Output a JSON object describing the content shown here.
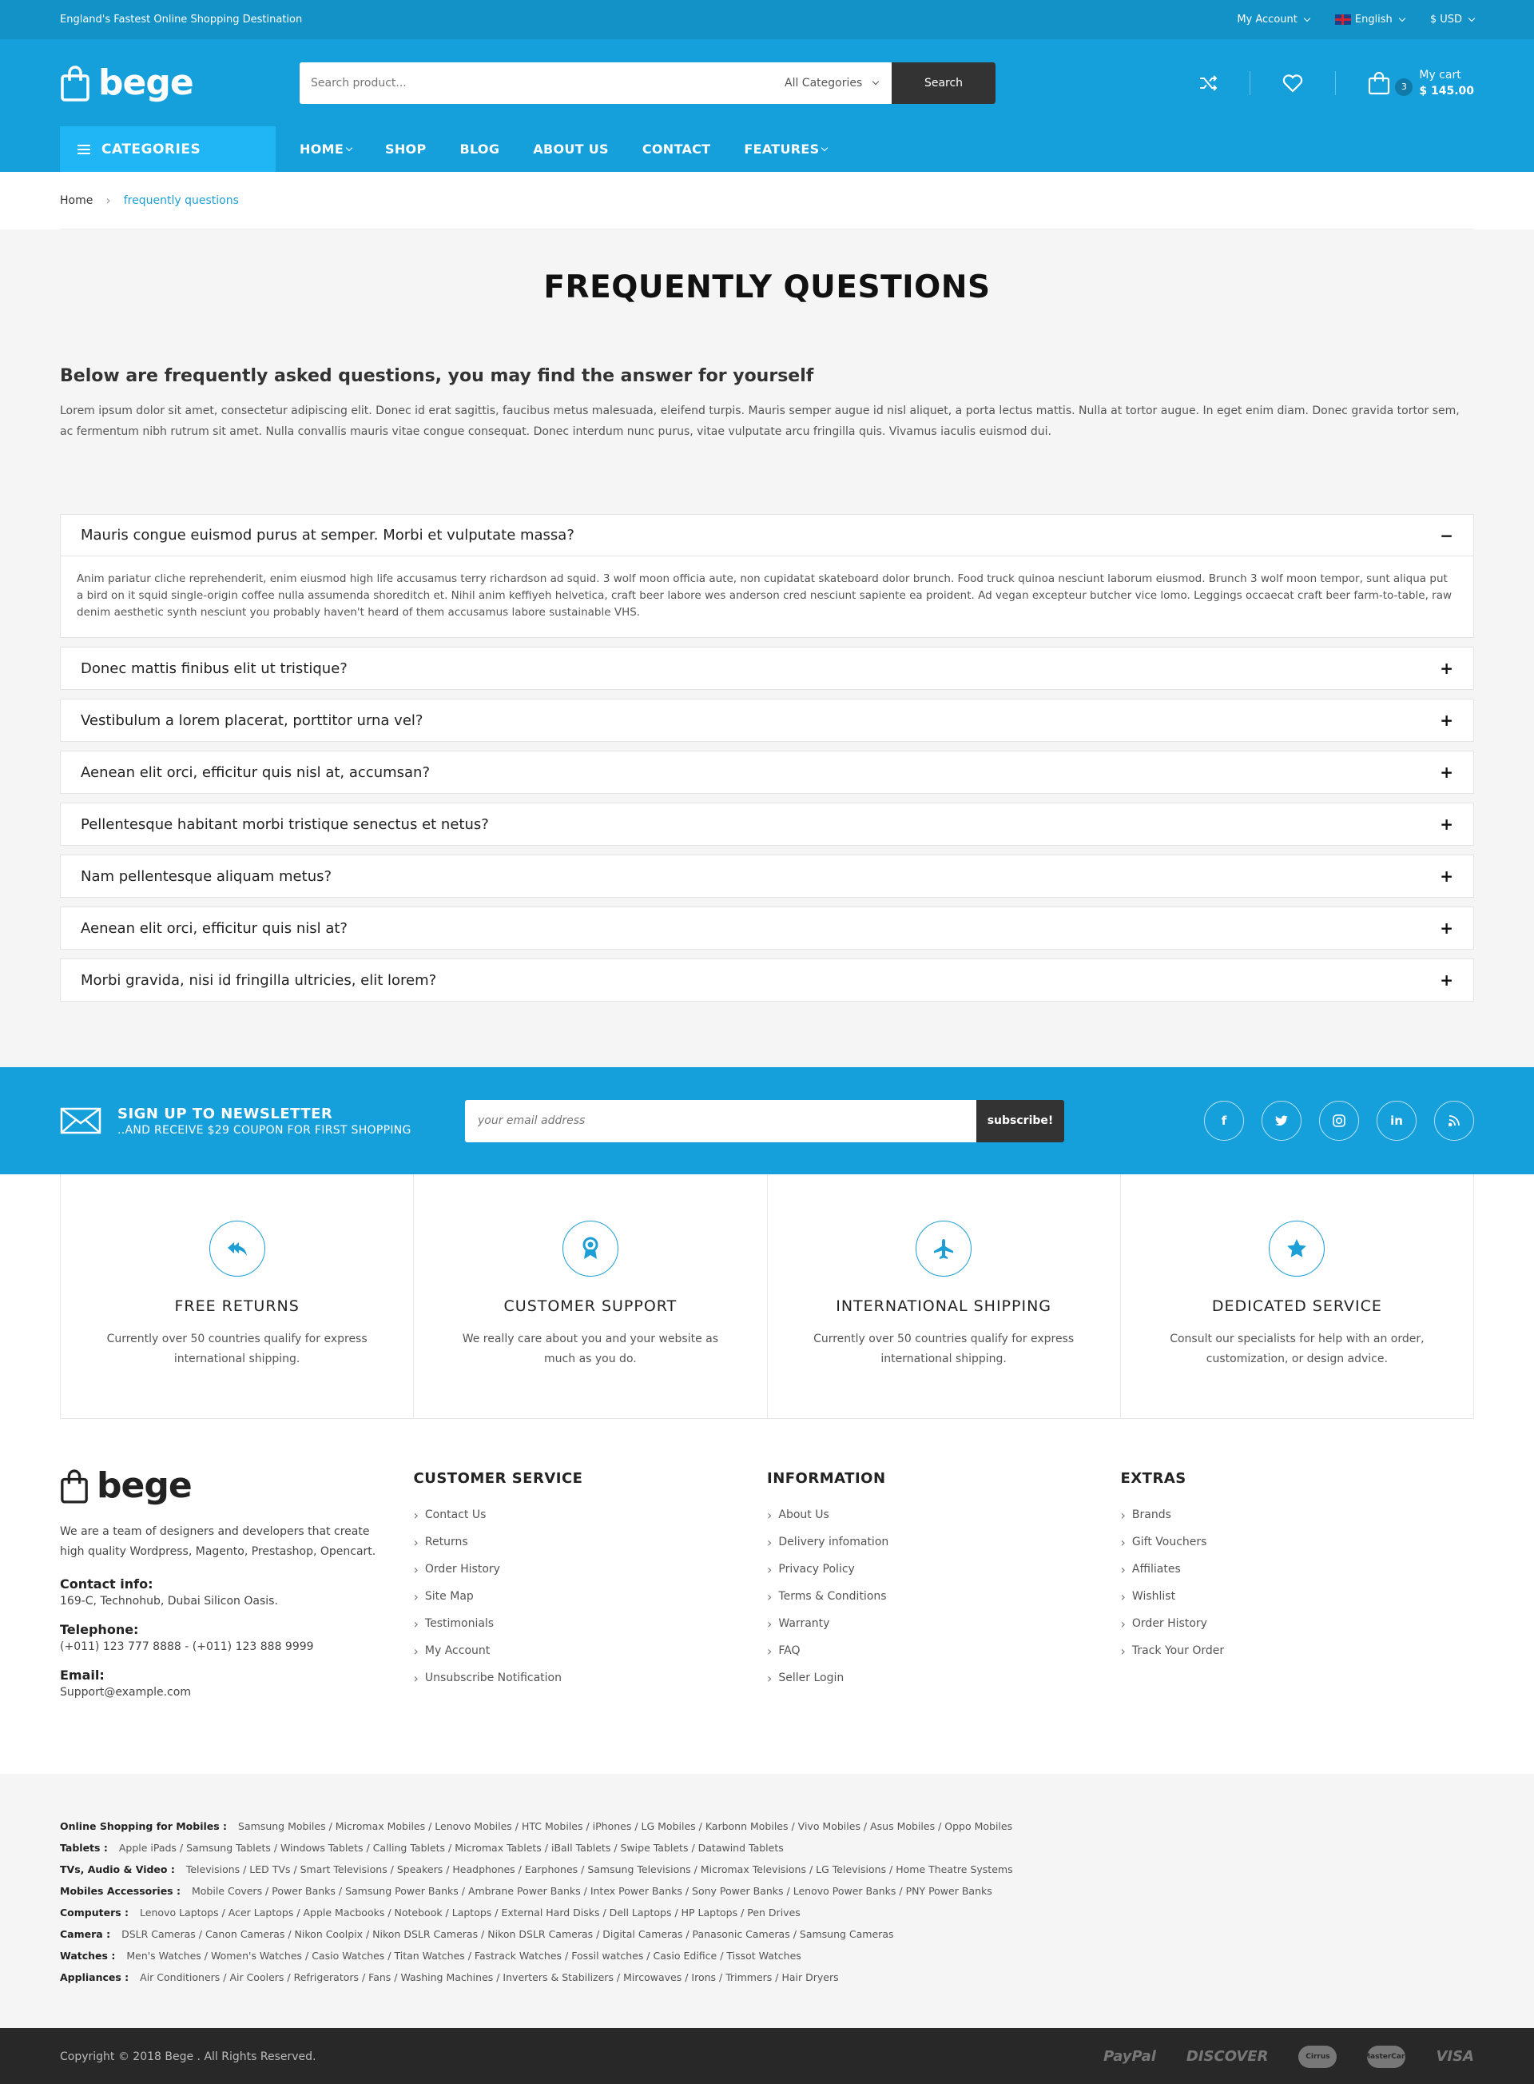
{
  "topbar": {
    "tagline": "England's Fastest Online Shopping Destination",
    "account": "My Account",
    "language": "English",
    "currency": "$ USD"
  },
  "header": {
    "logo": "bege",
    "search_placeholder": "Search product...",
    "category_select": "All Categories",
    "search_button": "Search",
    "cart_count": "3",
    "cart_label": "My cart",
    "cart_total": "$ 145.00"
  },
  "nav": {
    "categories": "CATEGORIES",
    "items": [
      "HOME",
      "SHOP",
      "BLOG",
      "ABOUT US",
      "CONTACT",
      "FEATURES"
    ]
  },
  "breadcrumb": {
    "home": "Home",
    "current": "frequently questions"
  },
  "page": {
    "title": "FREQUENTLY QUESTIONS",
    "intro_heading": "Below are frequently asked questions, you may find the answer for yourself",
    "intro_text": "Lorem ipsum dolor sit amet, consectetur adipiscing elit. Donec id erat sagittis, faucibus metus malesuada, eleifend turpis. Mauris semper augue id nisl aliquet, a porta lectus mattis. Nulla at tortor augue. In eget enim diam. Donec gravida tortor sem, ac fermentum nibh rutrum sit amet. Nulla convallis mauris vitae congue consequat. Donec interdum nunc purus, vitae vulputate arcu fringilla quis. Vivamus iaculis euismod dui."
  },
  "faq": [
    {
      "q": "Mauris congue euismod purus at semper. Morbi et vulputate massa?",
      "a": "Anim pariatur cliche reprehenderit, enim eiusmod high life accusamus terry richardson ad squid. 3 wolf moon officia aute, non cupidatat skateboard dolor brunch. Food truck quinoa nesciunt laborum eiusmod. Brunch 3 wolf moon tempor, sunt aliqua put a bird on it squid single-origin coffee nulla assumenda shoreditch et. Nihil anim keffiyeh helvetica, craft beer labore wes anderson cred nesciunt sapiente ea proident. Ad vegan excepteur butcher vice lomo. Leggings occaecat craft beer farm-to-table, raw denim aesthetic synth nesciunt you probably haven't heard of them accusamus labore sustainable VHS.",
      "open_sign": "−"
    },
    {
      "q": "Donec mattis finibus elit ut tristique?",
      "sign": "+"
    },
    {
      "q": "Vestibulum a lorem placerat, porttitor urna vel?",
      "sign": "+"
    },
    {
      "q": "Aenean elit orci, efficitur quis nisl at, accumsan?",
      "sign": "+"
    },
    {
      "q": "Pellentesque habitant morbi tristique senectus et netus?",
      "sign": "+"
    },
    {
      "q": "Nam pellentesque aliquam metus?",
      "sign": "+"
    },
    {
      "q": "Aenean elit orci, efficitur quis nisl at?",
      "sign": "+"
    },
    {
      "q": "Morbi gravida, nisi id fringilla ultricies, elit lorem?",
      "sign": "+"
    }
  ],
  "newsletter": {
    "title": "SIGN UP TO NEWSLETTER",
    "subtitle": "..AND RECEIVE $29 COUPON FOR FIRST SHOPPING",
    "placeholder": "your email address",
    "button": "subscribe!",
    "social": [
      "f",
      "t",
      "ig",
      "in",
      "rss"
    ]
  },
  "services": [
    {
      "title": "FREE RETURNS",
      "text": "Currently over 50 countries qualify for express international shipping.",
      "icon": "return-icon"
    },
    {
      "title": "CUSTOMER SUPPORT",
      "text": "We really care about you and your website as much as you do.",
      "icon": "award-icon"
    },
    {
      "title": "INTERNATIONAL SHIPPING",
      "text": "Currently over 50 countries qualify for express international shipping.",
      "icon": "plane-icon"
    },
    {
      "title": "DEDICATED SERVICE",
      "text": "Consult our specialists for help with an order, customization, or design advice.",
      "icon": "star-icon"
    }
  ],
  "footer": {
    "about": "We are a team of designers and developers that create high quality Wordpress, Magento, Prestashop, Opencart.",
    "contact_label": "Contact info:",
    "contact": "169-C, Technohub, Dubai Silicon Oasis.",
    "phone_label": "Telephone:",
    "phone": "(+011) 123 777 8888 - (+011) 123 888 9999",
    "email_label": "Email:",
    "email": "Support@example.com",
    "col1_title": "CUSTOMER SERVICE",
    "col1": [
      "Contact Us",
      "Returns",
      "Order History",
      "Site Map",
      "Testimonials",
      "My Account",
      "Unsubscribe Notification"
    ],
    "col2_title": "INFORMATION",
    "col2": [
      "About Us",
      "Delivery infomation",
      "Privacy Policy",
      "Terms & Conditions",
      "Warranty",
      "FAQ",
      "Seller Login"
    ],
    "col3_title": "EXTRAS",
    "col3": [
      "Brands",
      "Gift Vouchers",
      "Affiliates",
      "Wishlist",
      "Order History",
      "Track Your Order"
    ]
  },
  "links": [
    {
      "label": "Online Shopping for Mobiles :",
      "items": "Samsung Mobiles / Micromax Mobiles / Lenovo Mobiles / HTC Mobiles / iPhones / LG Mobiles / Karbonn Mobiles / Vivo Mobiles / Asus Mobiles / Oppo Mobiles"
    },
    {
      "label": "Tablets :",
      "items": "Apple iPads / Samsung Tablets / Windows Tablets / Calling Tablets / Micromax Tablets / iBall Tablets / Swipe Tablets / Datawind Tablets"
    },
    {
      "label": "TVs, Audio & Video :",
      "items": "Televisions / LED TVs / Smart Televisions / Speakers / Headphones / Earphones / Samsung Televisions / Micromax Televisions / LG Televisions / Home Theatre Systems"
    },
    {
      "label": "Mobiles Accessories :",
      "items": "Mobile Covers / Power Banks / Samsung Power Banks / Ambrane Power Banks / Intex Power Banks / Sony Power Banks / Lenovo Power Banks / PNY Power Banks"
    },
    {
      "label": "Computers :",
      "items": "Lenovo Laptops / Acer Laptops / Apple Macbooks / Notebook / Laptops / External Hard Disks / Dell Laptops / HP Laptops / Pen Drives"
    },
    {
      "label": "Camera :",
      "items": "DSLR Cameras / Canon Cameras / Nikon Coolpix / Nikon DSLR Cameras / Nikon DSLR Cameras / Digital Cameras / Panasonic Cameras / Samsung Cameras"
    },
    {
      "label": "Watches :",
      "items": "Men's Watches / Women's Watches / Casio Watches / Titan Watches / Fastrack Watches / Fossil watches / Casio Edifice / Tissot Watches"
    },
    {
      "label": "Appliances :",
      "items": "Air Conditioners / Air Coolers / Refrigerators / Fans / Washing Machines / Inverters & Stabilizers / Mircowaves / Irons / Trimmers / Hair Dryers"
    }
  ],
  "bottom": {
    "copyright": "Copyright © 2018 Bege . All Rights Reserved.",
    "payments": [
      "PayPal",
      "DISCOVER",
      "Cirrus",
      "MasterCard",
      "VISA"
    ]
  },
  "colors": {
    "brand": "#159fdb",
    "accent": "#20b5f4",
    "dark": "#282828"
  }
}
